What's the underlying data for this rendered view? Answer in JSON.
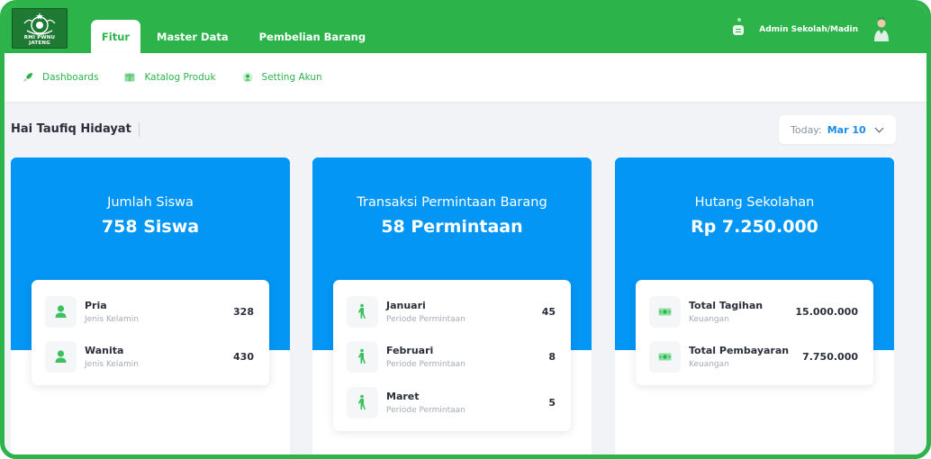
{
  "header": {
    "logo_text": "RMI PWNU JATENG",
    "tabs": [
      {
        "label": "Fitur",
        "active": true
      },
      {
        "label": "Master Data",
        "active": false
      },
      {
        "label": "Pembelian Barang",
        "active": false
      }
    ],
    "user_name": "Admin Sekolah/Madin"
  },
  "subnav": {
    "items": [
      {
        "label": "Dashboards",
        "icon": "rocket-icon"
      },
      {
        "label": "Katalog Produk",
        "icon": "book-icon"
      },
      {
        "label": "Setting Akun",
        "icon": "user-icon"
      }
    ]
  },
  "greeting": "Hai Taufiq Hidayat",
  "today": {
    "label": "Today:",
    "value": "Mar 10"
  },
  "colors": {
    "green": "#2cb34a",
    "blue": "#0396f5",
    "accent_text": "#1a8ce8"
  },
  "cards": [
    {
      "title": "Jumlah Siswa",
      "value": "758 Siswa",
      "icon": "person-icon",
      "rows": [
        {
          "label": "Pria",
          "sub": "Jenis Kelamin",
          "value": "328"
        },
        {
          "label": "Wanita",
          "sub": "Jenis Kelamin",
          "value": "430"
        }
      ]
    },
    {
      "title": "Transaksi Permintaan Barang",
      "value": "58 Permintaan",
      "icon": "walking-icon",
      "rows": [
        {
          "label": "Januari",
          "sub": "Periode Permintaan",
          "value": "45"
        },
        {
          "label": "Februari",
          "sub": "Periode Permintaan",
          "value": "8"
        },
        {
          "label": "Maret",
          "sub": "Periode Permintaan",
          "value": "5"
        }
      ]
    },
    {
      "title": "Hutang Sekolahan",
      "value": "Rp 7.250.000",
      "icon": "money-icon",
      "rows": [
        {
          "label": "Total Tagihan",
          "sub": "Keuangan",
          "value": "15.000.000"
        },
        {
          "label": "Total Pembayaran",
          "sub": "Keuangan",
          "value": "7.750.000"
        }
      ]
    }
  ]
}
